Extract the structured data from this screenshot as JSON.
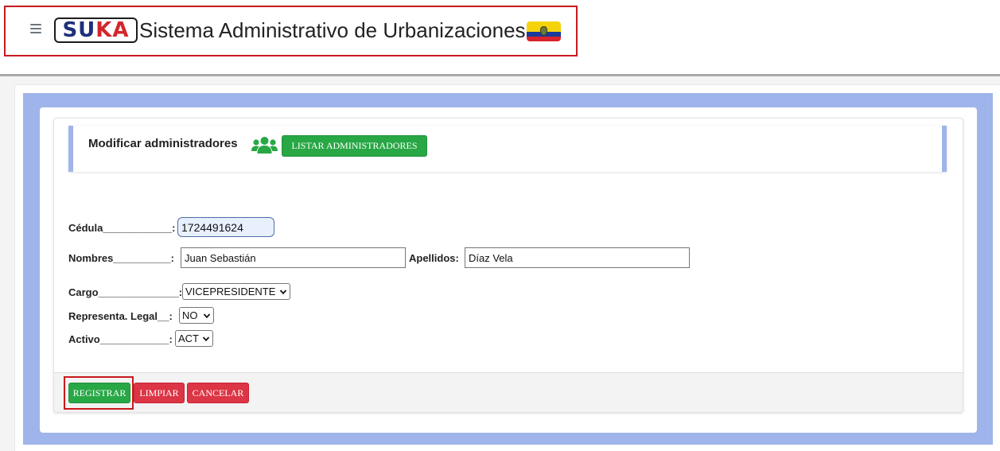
{
  "header": {
    "menu_icon": "hamburger-menu-icon",
    "logo_parts": [
      "SU",
      "KA"
    ],
    "app_title": "Sistema Administrativo de Urbanizaciones",
    "flag_icon": "ecuador-flag-icon"
  },
  "section": {
    "title": "Modificar administradores",
    "icon": "users-group-icon",
    "list_button": "LISTAR ADMINISTRADORES"
  },
  "form": {
    "cedula_label": "Cédula____________:",
    "cedula_value": "1724491624",
    "nombres_label": "Nombres__________:",
    "nombres_value": "Juan Sebastián",
    "apellidos_label": "Apellidos:",
    "apellidos_value": "Díaz Vela",
    "cargo_label": "Cargo______________:",
    "cargo_value": "VICEPRESIDENTE",
    "representa_label": "Representa. Legal__:",
    "representa_value": "NO",
    "activo_label": "Activo____________:",
    "activo_value": "ACT"
  },
  "footer": {
    "registrar": "REGISTRAR",
    "limpiar": "LIMPIAR",
    "cancelar": "CANCELAR"
  },
  "colors": {
    "primary_green": "#28a745",
    "danger_red": "#dc3545",
    "panel_blue": "#9fb4ea",
    "highlight_red": "#c8191e"
  }
}
